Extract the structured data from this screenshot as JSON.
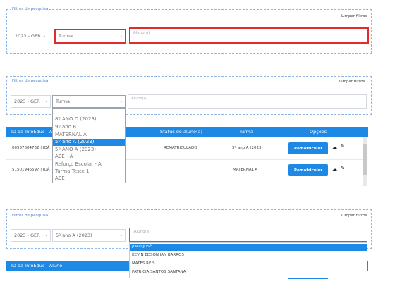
{
  "filter": {
    "legend": "Filtros de pesquisa",
    "clear": "Limpar filtros",
    "year": "2023 - GER",
    "class_placeholder": "Turma",
    "student_placeholder": "Aluno(a)",
    "selected_class": "5º ano A (2023)",
    "typed": "|Aluno(a)"
  },
  "class_options": [
    "8º ANO D (2023)",
    "9º ano B",
    "MATERNAL A",
    "5º ano A (2023)",
    "5º ANO A (2023)",
    "AEE - A",
    "Reforço Escolar - A",
    "Turma Teste 1",
    "AEE"
  ],
  "table": {
    "headers": {
      "id": "ID da InfoEduc | A",
      "id_full": "ID da InfoEduc | Aluno",
      "status": "Status do aluno(a)",
      "class": "Turma",
      "options": "Opções"
    },
    "rows": [
      {
        "id": "00537604732 | JOÃ",
        "status": "REMATRICULADO",
        "class": "5º ano A (2023)",
        "button": "Rematricular"
      },
      {
        "id": "51501946597 | JOÃ",
        "status": "",
        "class": "MATERNAL A",
        "button": "Rematricular"
      }
    ]
  },
  "students": [
    "JOAO JOSÉ",
    "KEVIN EDSON JAN BARROS",
    "MATES REIS",
    "PATRÍCIA SANTOS SANTANA"
  ],
  "icons": {
    "cloud": "cloud-download-icon",
    "edit": "edit-icon",
    "chevron": "chevron-down-icon"
  }
}
